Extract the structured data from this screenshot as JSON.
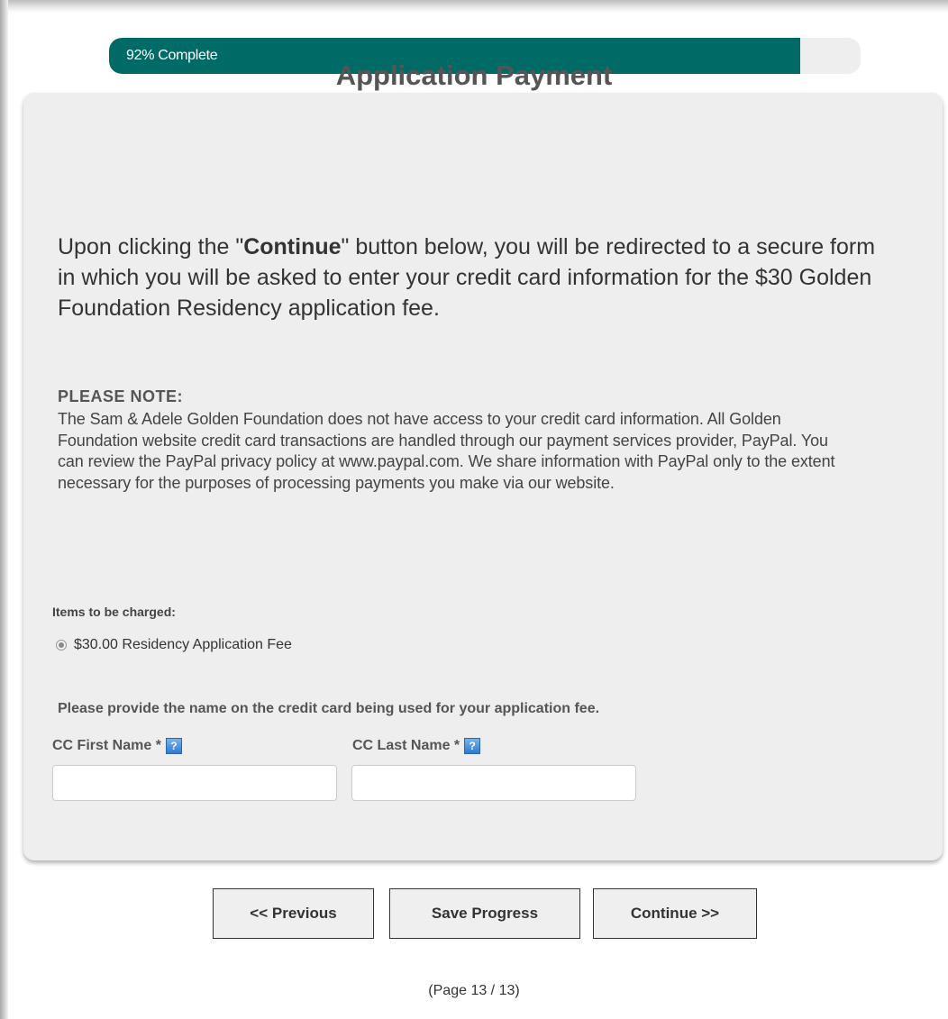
{
  "progress": {
    "percent": 92,
    "label": "92% Complete"
  },
  "payment": {
    "title": "Application Payment",
    "intro": {
      "before": "Upon clicking the \"",
      "bold": "Continue",
      "after": "\" button below, you will be redirected to a secure form in which you will be asked to enter your credit card information for the $30 Golden Foundation Residency application fee."
    },
    "note_heading": "PLEASE NOTE:",
    "note_body": "The Sam & Adele Golden Foundation does not have access to your credit card information.  All Golden Foundation website credit card transactions are handled through our payment services provider, PayPal. You can review the PayPal privacy policy at www.paypal.com.  We share information with PayPal only to the extent necessary for the purposes of processing payments you make via our website.",
    "items_label": "Items to be charged:",
    "item_option": "$30.00 Residency Application Fee",
    "provide_text": "Please provide the name on the credit card being used for your application fee.",
    "first_name_label": "CC First Name *",
    "last_name_label": "CC Last Name *",
    "first_name_value": "",
    "last_name_value": "",
    "help_icon_glyph": "?"
  },
  "buttons": {
    "previous": "<< Previous",
    "save": "Save Progress",
    "continue": "Continue >>"
  },
  "page_indicator": "(Page 13 / 13)",
  "colors": {
    "progress_fill": "#006b66",
    "panel_background": "#eeeeee",
    "help_icon": "#2e7ad1"
  }
}
